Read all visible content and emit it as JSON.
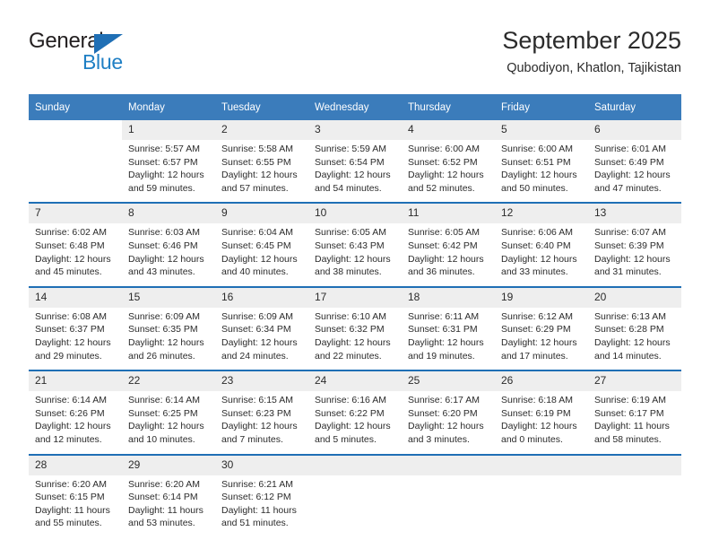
{
  "brand": {
    "name_part1": "General",
    "name_part2": "Blue",
    "triangle_color": "#1f6fb5",
    "blue_color": "#1f7fc4"
  },
  "header": {
    "month_title": "September 2025",
    "location": "Qubodiyon, Khatlon, Tajikistan"
  },
  "theme": {
    "header_bg": "#3b7cbb",
    "separator": "#1f6fb5",
    "daynum_bg": "#eeeeee"
  },
  "weekdays": [
    "Sunday",
    "Monday",
    "Tuesday",
    "Wednesday",
    "Thursday",
    "Friday",
    "Saturday"
  ],
  "weeks": [
    {
      "days": [
        {
          "num": "",
          "sunrise": "",
          "sunset": "",
          "daylight1": "",
          "daylight2": ""
        },
        {
          "num": "1",
          "sunrise": "Sunrise: 5:57 AM",
          "sunset": "Sunset: 6:57 PM",
          "daylight1": "Daylight: 12 hours",
          "daylight2": "and 59 minutes."
        },
        {
          "num": "2",
          "sunrise": "Sunrise: 5:58 AM",
          "sunset": "Sunset: 6:55 PM",
          "daylight1": "Daylight: 12 hours",
          "daylight2": "and 57 minutes."
        },
        {
          "num": "3",
          "sunrise": "Sunrise: 5:59 AM",
          "sunset": "Sunset: 6:54 PM",
          "daylight1": "Daylight: 12 hours",
          "daylight2": "and 54 minutes."
        },
        {
          "num": "4",
          "sunrise": "Sunrise: 6:00 AM",
          "sunset": "Sunset: 6:52 PM",
          "daylight1": "Daylight: 12 hours",
          "daylight2": "and 52 minutes."
        },
        {
          "num": "5",
          "sunrise": "Sunrise: 6:00 AM",
          "sunset": "Sunset: 6:51 PM",
          "daylight1": "Daylight: 12 hours",
          "daylight2": "and 50 minutes."
        },
        {
          "num": "6",
          "sunrise": "Sunrise: 6:01 AM",
          "sunset": "Sunset: 6:49 PM",
          "daylight1": "Daylight: 12 hours",
          "daylight2": "and 47 minutes."
        }
      ]
    },
    {
      "days": [
        {
          "num": "7",
          "sunrise": "Sunrise: 6:02 AM",
          "sunset": "Sunset: 6:48 PM",
          "daylight1": "Daylight: 12 hours",
          "daylight2": "and 45 minutes."
        },
        {
          "num": "8",
          "sunrise": "Sunrise: 6:03 AM",
          "sunset": "Sunset: 6:46 PM",
          "daylight1": "Daylight: 12 hours",
          "daylight2": "and 43 minutes."
        },
        {
          "num": "9",
          "sunrise": "Sunrise: 6:04 AM",
          "sunset": "Sunset: 6:45 PM",
          "daylight1": "Daylight: 12 hours",
          "daylight2": "and 40 minutes."
        },
        {
          "num": "10",
          "sunrise": "Sunrise: 6:05 AM",
          "sunset": "Sunset: 6:43 PM",
          "daylight1": "Daylight: 12 hours",
          "daylight2": "and 38 minutes."
        },
        {
          "num": "11",
          "sunrise": "Sunrise: 6:05 AM",
          "sunset": "Sunset: 6:42 PM",
          "daylight1": "Daylight: 12 hours",
          "daylight2": "and 36 minutes."
        },
        {
          "num": "12",
          "sunrise": "Sunrise: 6:06 AM",
          "sunset": "Sunset: 6:40 PM",
          "daylight1": "Daylight: 12 hours",
          "daylight2": "and 33 minutes."
        },
        {
          "num": "13",
          "sunrise": "Sunrise: 6:07 AM",
          "sunset": "Sunset: 6:39 PM",
          "daylight1": "Daylight: 12 hours",
          "daylight2": "and 31 minutes."
        }
      ]
    },
    {
      "days": [
        {
          "num": "14",
          "sunrise": "Sunrise: 6:08 AM",
          "sunset": "Sunset: 6:37 PM",
          "daylight1": "Daylight: 12 hours",
          "daylight2": "and 29 minutes."
        },
        {
          "num": "15",
          "sunrise": "Sunrise: 6:09 AM",
          "sunset": "Sunset: 6:35 PM",
          "daylight1": "Daylight: 12 hours",
          "daylight2": "and 26 minutes."
        },
        {
          "num": "16",
          "sunrise": "Sunrise: 6:09 AM",
          "sunset": "Sunset: 6:34 PM",
          "daylight1": "Daylight: 12 hours",
          "daylight2": "and 24 minutes."
        },
        {
          "num": "17",
          "sunrise": "Sunrise: 6:10 AM",
          "sunset": "Sunset: 6:32 PM",
          "daylight1": "Daylight: 12 hours",
          "daylight2": "and 22 minutes."
        },
        {
          "num": "18",
          "sunrise": "Sunrise: 6:11 AM",
          "sunset": "Sunset: 6:31 PM",
          "daylight1": "Daylight: 12 hours",
          "daylight2": "and 19 minutes."
        },
        {
          "num": "19",
          "sunrise": "Sunrise: 6:12 AM",
          "sunset": "Sunset: 6:29 PM",
          "daylight1": "Daylight: 12 hours",
          "daylight2": "and 17 minutes."
        },
        {
          "num": "20",
          "sunrise": "Sunrise: 6:13 AM",
          "sunset": "Sunset: 6:28 PM",
          "daylight1": "Daylight: 12 hours",
          "daylight2": "and 14 minutes."
        }
      ]
    },
    {
      "days": [
        {
          "num": "21",
          "sunrise": "Sunrise: 6:14 AM",
          "sunset": "Sunset: 6:26 PM",
          "daylight1": "Daylight: 12 hours",
          "daylight2": "and 12 minutes."
        },
        {
          "num": "22",
          "sunrise": "Sunrise: 6:14 AM",
          "sunset": "Sunset: 6:25 PM",
          "daylight1": "Daylight: 12 hours",
          "daylight2": "and 10 minutes."
        },
        {
          "num": "23",
          "sunrise": "Sunrise: 6:15 AM",
          "sunset": "Sunset: 6:23 PM",
          "daylight1": "Daylight: 12 hours",
          "daylight2": "and 7 minutes."
        },
        {
          "num": "24",
          "sunrise": "Sunrise: 6:16 AM",
          "sunset": "Sunset: 6:22 PM",
          "daylight1": "Daylight: 12 hours",
          "daylight2": "and 5 minutes."
        },
        {
          "num": "25",
          "sunrise": "Sunrise: 6:17 AM",
          "sunset": "Sunset: 6:20 PM",
          "daylight1": "Daylight: 12 hours",
          "daylight2": "and 3 minutes."
        },
        {
          "num": "26",
          "sunrise": "Sunrise: 6:18 AM",
          "sunset": "Sunset: 6:19 PM",
          "daylight1": "Daylight: 12 hours",
          "daylight2": "and 0 minutes."
        },
        {
          "num": "27",
          "sunrise": "Sunrise: 6:19 AM",
          "sunset": "Sunset: 6:17 PM",
          "daylight1": "Daylight: 11 hours",
          "daylight2": "and 58 minutes."
        }
      ]
    },
    {
      "days": [
        {
          "num": "28",
          "sunrise": "Sunrise: 6:20 AM",
          "sunset": "Sunset: 6:15 PM",
          "daylight1": "Daylight: 11 hours",
          "daylight2": "and 55 minutes."
        },
        {
          "num": "29",
          "sunrise": "Sunrise: 6:20 AM",
          "sunset": "Sunset: 6:14 PM",
          "daylight1": "Daylight: 11 hours",
          "daylight2": "and 53 minutes."
        },
        {
          "num": "30",
          "sunrise": "Sunrise: 6:21 AM",
          "sunset": "Sunset: 6:12 PM",
          "daylight1": "Daylight: 11 hours",
          "daylight2": "and 51 minutes."
        },
        {
          "num": "",
          "sunrise": "",
          "sunset": "",
          "daylight1": "",
          "daylight2": ""
        },
        {
          "num": "",
          "sunrise": "",
          "sunset": "",
          "daylight1": "",
          "daylight2": ""
        },
        {
          "num": "",
          "sunrise": "",
          "sunset": "",
          "daylight1": "",
          "daylight2": ""
        },
        {
          "num": "",
          "sunrise": "",
          "sunset": "",
          "daylight1": "",
          "daylight2": ""
        }
      ]
    }
  ]
}
